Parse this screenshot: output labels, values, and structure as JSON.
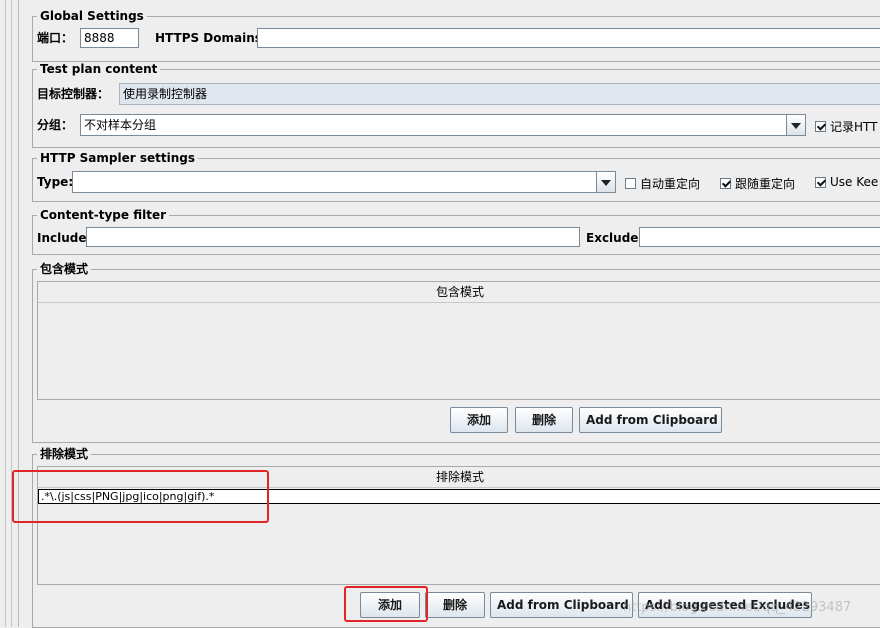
{
  "global_settings": {
    "legend": "Global Settings",
    "port_label": "端口：",
    "port_value": "8888",
    "https_domains_label": "HTTPS Domains :",
    "https_domains_value": ""
  },
  "test_plan": {
    "legend": "Test plan content",
    "target_controller_label": "目标控制器：",
    "target_controller_value": "使用录制控制器",
    "grouping_label": "分组：",
    "grouping_value": "不对样本分组",
    "record_checkbox_label": "记录HTT",
    "record_checked": true
  },
  "http_sampler": {
    "legend": "HTTP Sampler settings",
    "type_label": "Type:",
    "type_value": "",
    "auto_redirect_label": "自动重定向",
    "auto_redirect_checked": false,
    "follow_redirect_label": "跟随重定向",
    "follow_redirect_checked": true,
    "keepalive_label": "Use Kee",
    "keepalive_checked": true
  },
  "content_type_filter": {
    "legend": "Content-type filter",
    "include_label": "Include:",
    "include_value": "",
    "exclude_label": "Exclude:",
    "exclude_value": ""
  },
  "include_patterns": {
    "legend": "包含模式",
    "column_header": "包含模式",
    "rows": [],
    "add_button": "添加",
    "delete_button": "删除",
    "clipboard_button": "Add from Clipboard"
  },
  "exclude_patterns": {
    "legend": "排除模式",
    "column_header": "排除模式",
    "rows": [
      ".*\\.(js|css|PNG|jpg|ico|png|gif).*"
    ],
    "add_button": "添加",
    "delete_button": "删除",
    "clipboard_button": "Add from Clipboard",
    "suggested_button": "Add suggested Excludes"
  },
  "watermark": "https://blog.csdn.net/qq_42293487",
  "colors": {
    "highlight_red": "#e0262a",
    "background": "#eeeeee"
  }
}
